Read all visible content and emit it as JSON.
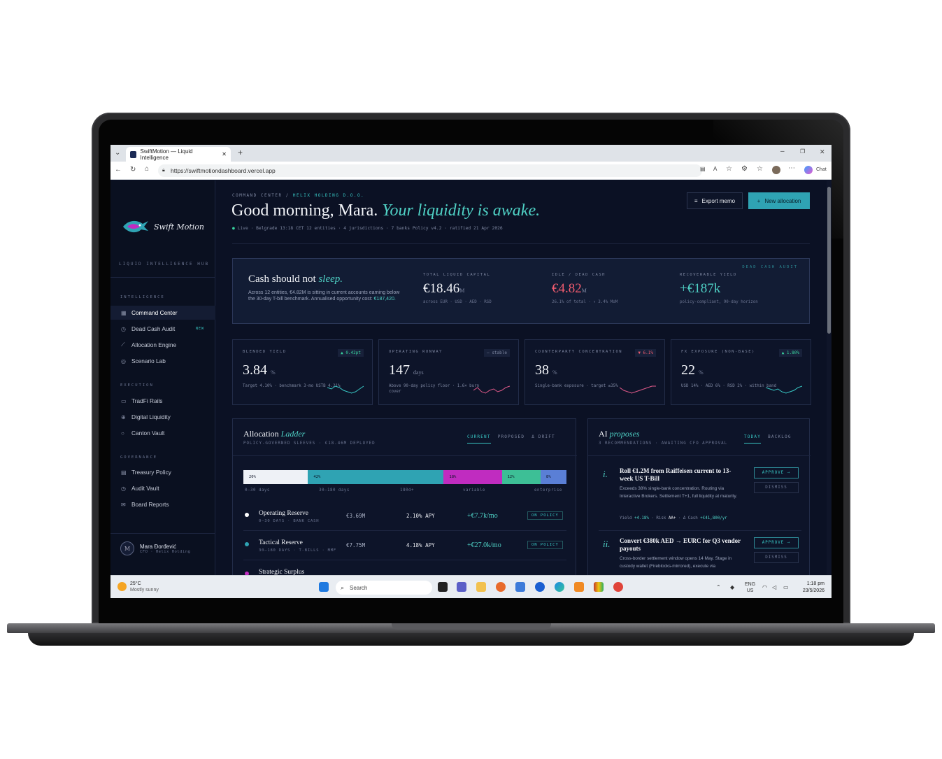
{
  "browser": {
    "tab_title": "SwiftMotion — Liquid Intelligence",
    "url": "https://swiftmotiondashboard.vercel.app",
    "chat_label": "Chat"
  },
  "sidebar": {
    "brand": "Swift Motion",
    "subtitle": "LIQUID INTELLIGENCE HUB",
    "sections": [
      {
        "title": "INTELLIGENCE",
        "items": [
          "Command Center",
          "Dead Cash Audit",
          "Allocation Engine",
          "Scenario Lab"
        ]
      },
      {
        "title": "EXECUTION",
        "items": [
          "TradFi Rails",
          "Digital Liquidity",
          "Canton Vault"
        ]
      },
      {
        "title": "GOVERNANCE",
        "items": [
          "Treasury Policy",
          "Audit Vault",
          "Board Reports"
        ]
      }
    ],
    "new_badge": "NEW",
    "user": {
      "initial": "M",
      "name": "Mara Đorđević",
      "role": "CFO · Helix Holding"
    }
  },
  "header": {
    "crumb_a": "COMMAND CENTER /",
    "crumb_b": "HELIX HOLDING D.O.O.",
    "greeting": "Good morning, Mara.",
    "greeting_em": "Your liquidity is awake.",
    "meta_live": "Live",
    "meta": "· Belgrade 13:18 CET   12 entities · 4 jurisdictions · 7 banks   Policy v4.2 · ratified 21 Apr 2026",
    "export_label": "Export memo",
    "new_label": "New allocation"
  },
  "hero": {
    "title": "Cash should not",
    "title_em": "sleep.",
    "desc": "Across 12 entities, €4.82M is sitting in current accounts earning below the 30-day T-bill benchmark. Annualised opportunity cost:",
    "desc_value": "€187,420.",
    "audit": "DEAD CASH AUDIT",
    "stats": [
      {
        "label": "TOTAL LIQUID CAPITAL",
        "value": "€18.46",
        "unit": "M",
        "sub": "across EUR · USD · AED · RSD",
        "color": "#f2f4f8"
      },
      {
        "label": "IDLE / DEAD CASH",
        "value": "€4.82",
        "unit": "M",
        "sub": "26.1% of total · ↑ 3.4% MoM",
        "color": "#ef5b6e"
      },
      {
        "label": "RECOVERABLE YIELD",
        "value": "+€187k",
        "unit": "",
        "sub": "policy-compliant, 90-day horizon",
        "color": "#4fd1c5"
      }
    ]
  },
  "kpis": [
    {
      "label": "BLENDED YIELD",
      "chip": "▲ 0.42pt",
      "chip_color": "#38d39f",
      "value": "3.84",
      "unit": "%",
      "sub": "Target 4.10% · benchmark 3-mo USTB 4.21%",
      "spark_color": "#38c7c4",
      "spark": [
        6,
        5,
        7,
        6,
        4,
        3,
        2,
        3,
        5,
        7
      ]
    },
    {
      "label": "OPERATING RUNWAY",
      "chip": "— stable",
      "chip_color": "#7d86a0",
      "value": "147",
      "unit": "days",
      "sub": "Above 90-day policy floor · 1.6× burn cover",
      "spark_color": "#e05a8a",
      "spark": [
        4,
        6,
        3,
        2,
        4,
        5,
        3,
        4,
        6,
        7
      ]
    },
    {
      "label": "COUNTERPARTY CONCENTRATION",
      "chip": "▼ 6.1%",
      "chip_color": "#ef5b6e",
      "value": "38",
      "unit": "%",
      "sub": "Single-bank exposure · target ≤35%",
      "spark_color": "#e05a8a",
      "spark": [
        6,
        4,
        3,
        2,
        3,
        4,
        5,
        6,
        7,
        7
      ]
    },
    {
      "label": "FX EXPOSURE (NON-BASE)",
      "chip": "▲ 1.80%",
      "chip_color": "#38d39f",
      "value": "22",
      "unit": "%",
      "sub": "USD 14% · AED 6% · RSD 2% · within band",
      "spark_color": "#38c7c4",
      "spark": [
        6,
        5,
        4,
        5,
        3,
        2,
        3,
        4,
        6,
        7
      ]
    }
  ],
  "allocation": {
    "title": "Allocation",
    "title_em": "Ladder",
    "sub": "POLICY-GOVERNED SLEEVES · €18.46M DEPLOYED",
    "tabs": [
      "CURRENT",
      "PROPOSED",
      "Δ DRIFT"
    ],
    "segments": [
      {
        "pct": 20,
        "label": "20%",
        "color": "#eef1f6"
      },
      {
        "pct": 42,
        "label": "42%",
        "color": "#2fa3b3"
      },
      {
        "pct": 18,
        "label": "18%",
        "color": "#c02cc0"
      },
      {
        "pct": 12,
        "label": "12%",
        "color": "#3dbf96"
      },
      {
        "pct": 8,
        "label": "8%",
        "color": "#5a7fd6"
      }
    ],
    "bands": [
      "0–30 days",
      "30–180 days",
      "180d+",
      "variable",
      "enterprise"
    ],
    "rows": [
      {
        "name": "Operating Reserve",
        "sub": "0–30 DAYS · BANK CASH",
        "amount": "€3.69M",
        "apy": "2.10% APY",
        "income": "+€7.7k/mo",
        "status": "ON POLICY",
        "color": "#ffffff"
      },
      {
        "name": "Tactical Reserve",
        "sub": "30–180 DAYS · T-BILLS · MMF",
        "amount": "€7.75M",
        "apy": "4.18% APY",
        "income": "+€27.0k/mo",
        "status": "ON POLICY",
        "color": "#2fa3b3"
      },
      {
        "name": "Strategic Surplus",
        "sub": "",
        "amount": "",
        "apy": "",
        "income": "",
        "status": "",
        "color": "#c02cc0"
      }
    ]
  },
  "ai": {
    "title": "AI",
    "title_em": "proposes",
    "sub": "3 RECOMMENDATIONS · AWAITING CFO APPROVAL",
    "tabs": [
      "TODAY",
      "BACKLOG"
    ],
    "approve": "APPROVE →",
    "dismiss": "DISMISS",
    "recs": [
      {
        "num": "i.",
        "title": "Roll €1.2M from Raiffeisen current to 13-week US T-Bill",
        "desc": "Exceeds 38% single-bank concentration. Routing via Interactive Brokers. Settlement T+1, full liquidity at maturity.",
        "m_yield": "Yield",
        "m_yield_v": "+4.18%",
        "m_risk": "Risk",
        "m_risk_v": "AA+",
        "m_cash": "Δ Cash",
        "m_cash_v": "+€41,800/yr"
      },
      {
        "num": "ii.",
        "title": "Convert €380k AED → EURC for Q3 vendor payouts",
        "desc": "Cross-border settlement window opens 14 May. Stage in custody wallet (Fireblocks-mirrored), execute via",
        "m_yield": "",
        "m_yield_v": "",
        "m_risk": "",
        "m_risk_v": "",
        "m_cash": "",
        "m_cash_v": ""
      }
    ]
  },
  "taskbar": {
    "temp": "25°C",
    "weather": "Mostly sunny",
    "search": "Search",
    "lang": "ENG",
    "region": "US",
    "time": "1:18 pm",
    "date": "23/5/2026"
  }
}
